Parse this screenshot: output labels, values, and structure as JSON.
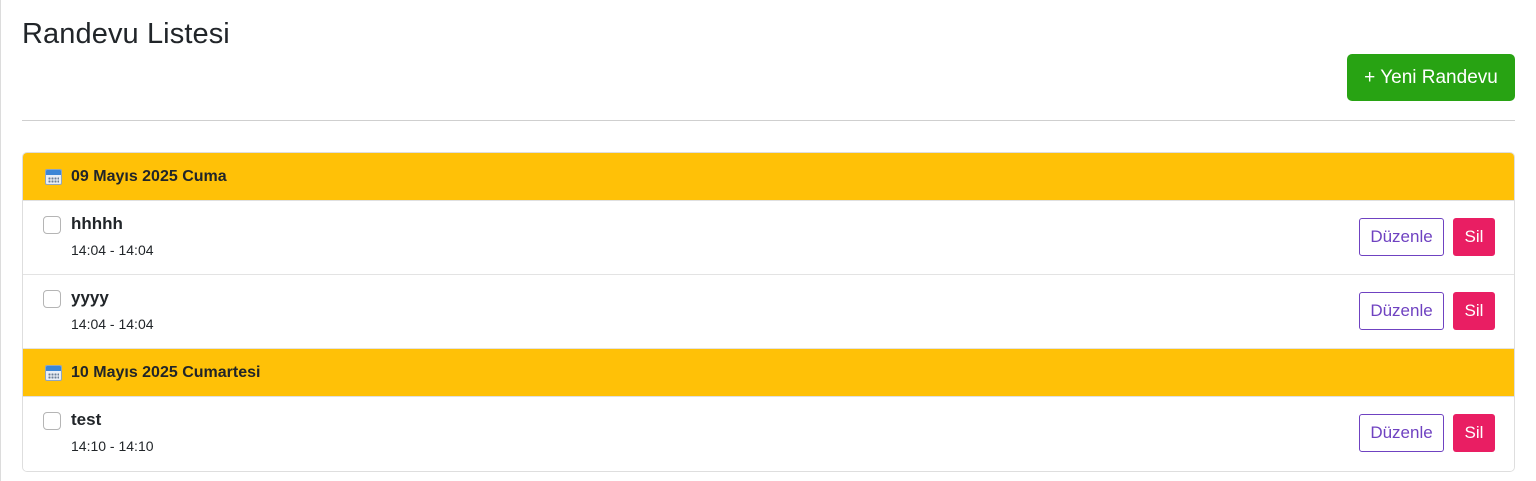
{
  "page": {
    "title": "Randevu Listesi",
    "new_button_label": "+ Yeni Randevu"
  },
  "colors": {
    "day_header_bg": "#ffc107",
    "new_button_bg": "#28a313",
    "edit_button_color": "#6f42c1",
    "delete_button_bg": "#e91e63"
  },
  "days": [
    {
      "label": "09 Mayıs 2025 Cuma",
      "icon": "calendar-icon",
      "appointments": [
        {
          "title": "hhhhh",
          "time": "14:04 - 14:04",
          "checked": false,
          "edit_label": "Düzenle",
          "delete_label": "Sil"
        },
        {
          "title": "yyyy",
          "time": "14:04 - 14:04",
          "checked": false,
          "edit_label": "Düzenle",
          "delete_label": "Sil"
        }
      ]
    },
    {
      "label": "10 Mayıs 2025 Cumartesi",
      "icon": "calendar-icon",
      "appointments": [
        {
          "title": "test",
          "time": "14:10 - 14:10",
          "checked": false,
          "edit_label": "Düzenle",
          "delete_label": "Sil"
        }
      ]
    }
  ]
}
